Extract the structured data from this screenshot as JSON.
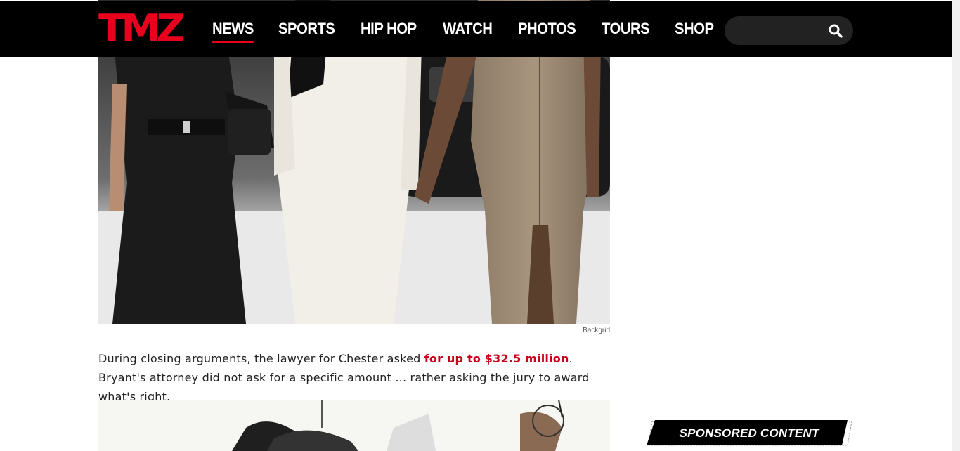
{
  "brand": {
    "logo_text": "TMZ",
    "accent": "#e8001c"
  },
  "nav": {
    "items": [
      {
        "label": "NEWS",
        "active": true
      },
      {
        "label": "SPORTS",
        "active": false
      },
      {
        "label": "HIP HOP",
        "active": false
      },
      {
        "label": "WATCH",
        "active": false
      },
      {
        "label": "PHOTOS",
        "active": false
      },
      {
        "label": "TOURS",
        "active": false
      },
      {
        "label": "SHOP",
        "active": false
      }
    ]
  },
  "search": {
    "placeholder": "",
    "icon": "search-icon"
  },
  "article": {
    "photo_credit": "Backgrid",
    "paragraph_start": "During closing arguments, the lawyer for Chester asked ",
    "paragraph_link": "for up to $32.5 million",
    "paragraph_end": ". Bryant's attorney did not ask for a specific amount ... rather asking the jury to award what's right."
  },
  "sidebar": {
    "sponsored_label": "SPONSORED CONTENT"
  }
}
